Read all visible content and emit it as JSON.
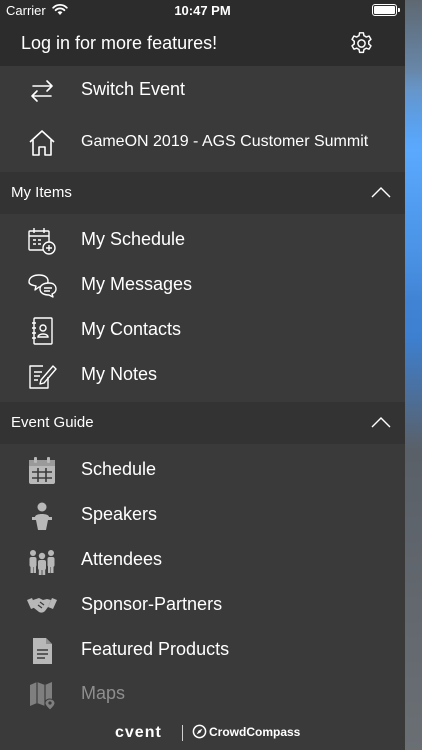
{
  "status_bar": {
    "carrier": "Carrier",
    "time": "10:47 PM"
  },
  "header": {
    "login_text": "Log in for more features!"
  },
  "top_items": [
    {
      "label": "Switch Event",
      "icon": "swap-arrows-icon"
    },
    {
      "label": "GameON 2019 - AGS Customer Summit",
      "icon": "home-icon"
    }
  ],
  "sections": {
    "my_items": {
      "title": "My Items",
      "items": [
        {
          "label": "My Schedule",
          "icon": "calendar-add-icon"
        },
        {
          "label": "My Messages",
          "icon": "chat-bubbles-icon"
        },
        {
          "label": "My Contacts",
          "icon": "contact-book-icon"
        },
        {
          "label": "My Notes",
          "icon": "note-pencil-icon"
        }
      ]
    },
    "event_guide": {
      "title": "Event Guide",
      "items": [
        {
          "label": "Schedule",
          "icon": "calendar-grid-icon"
        },
        {
          "label": "Speakers",
          "icon": "podium-speaker-icon"
        },
        {
          "label": "Attendees",
          "icon": "people-group-icon"
        },
        {
          "label": "Sponsor-Partners",
          "icon": "handshake-icon"
        },
        {
          "label": "Featured Products",
          "icon": "document-icon"
        },
        {
          "label": "Maps",
          "icon": "map-pin-icon"
        }
      ]
    }
  },
  "footer": {
    "brand_left": "cvent",
    "brand_right": "CrowdCompass"
  },
  "colors": {
    "drawer_bg": "#3a3a3a",
    "header_bg": "#2c2c2c",
    "section_bg": "#333333",
    "accent_blue": "#4a90e2"
  }
}
